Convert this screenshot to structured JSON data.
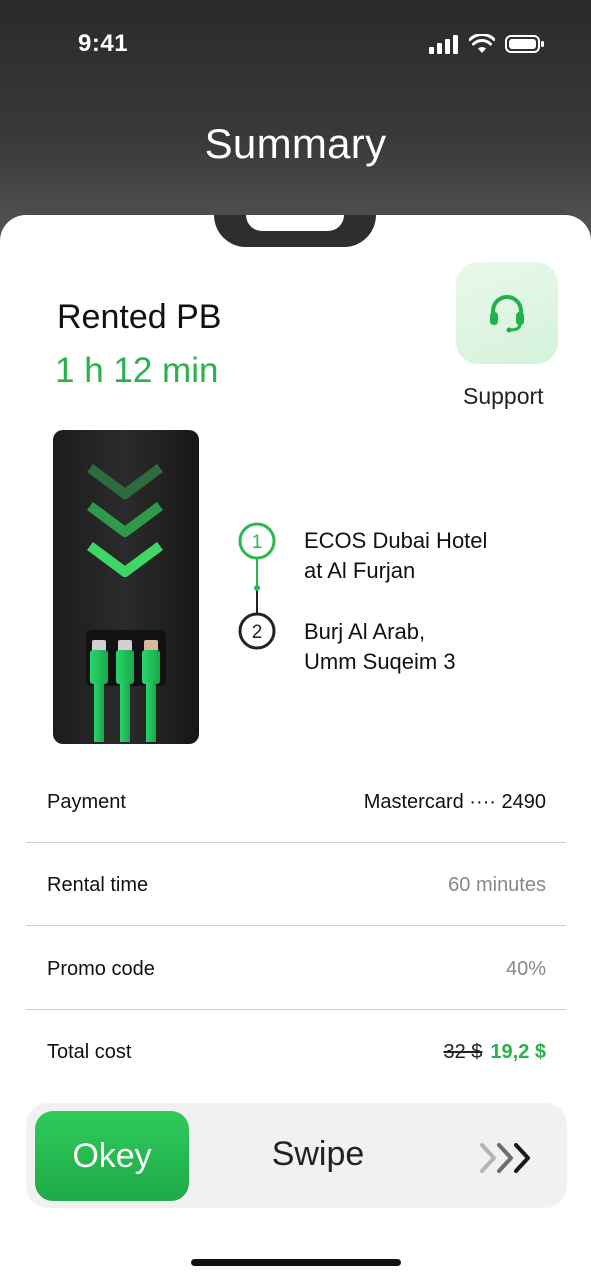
{
  "status_bar": {
    "time": "9:41"
  },
  "header": {
    "title": "Summary"
  },
  "rental": {
    "title": "Rented PB",
    "duration": "1 h 12 min"
  },
  "support": {
    "label": "Support",
    "icon": "headset-icon"
  },
  "route": {
    "stops": [
      {
        "number": "1",
        "line1": "ECOS Dubai Hotel",
        "line2": "at Al Furjan"
      },
      {
        "number": "2",
        "line1": "Burj Al Arab,",
        "line2": "Umm Suqeim 3"
      }
    ]
  },
  "details": {
    "payment": {
      "label": "Payment",
      "value": "Mastercard ···· 2490"
    },
    "rental_time": {
      "label": "Rental time",
      "value": "60 minutes"
    },
    "promo_code": {
      "label": "Promo code",
      "value": "40%"
    },
    "total_cost": {
      "label": "Total cost",
      "old_value": "32 $",
      "new_value": "19,2 $"
    }
  },
  "swipe": {
    "button_label": "Okey",
    "label": "Swipe"
  },
  "colors": {
    "accent": "#27b24a",
    "header_dark": "#2a2a2a",
    "track": "#f1f1f1"
  }
}
